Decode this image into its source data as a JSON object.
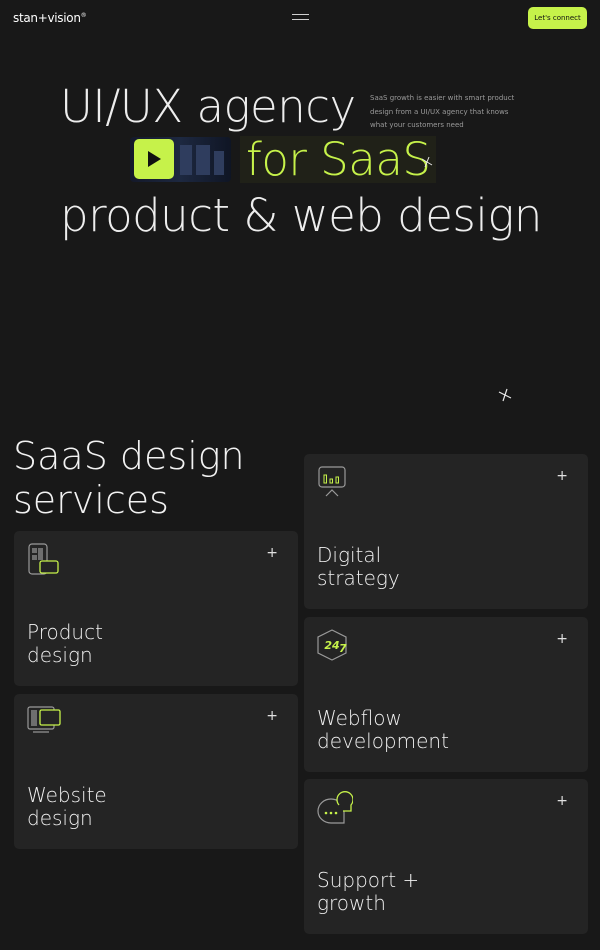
{
  "header": {
    "logo_text": "stan+vision",
    "logo_mark": "®",
    "menu_icon": "hamburger-icon",
    "cta_label": "Let's connect",
    "accent_color": "#c6f24a"
  },
  "hero": {
    "line1": "UI/UX agency",
    "line2": "for SaaS",
    "line3": "product & web design",
    "aside": "SaaS growth is easier with smart product design from a UI/UX agency that knows what your customers need",
    "play_icon": "play-icon"
  },
  "services": {
    "title_line1": "SaaS design",
    "title_line2": "services",
    "left": [
      {
        "line1": "Product",
        "line2": "design",
        "icon": "mobile-app-icon"
      },
      {
        "line1": "Website",
        "line2": "design",
        "icon": "browser-window-icon"
      }
    ],
    "right": [
      {
        "line1": "Digital",
        "line2": "strategy",
        "icon": "analytics-chart-icon"
      },
      {
        "line1": "Webflow",
        "line2": "development",
        "icon": "webflow-247-icon"
      },
      {
        "line1": "Support +",
        "line2": "growth",
        "icon": "chat-bubble-icon"
      }
    ],
    "plus_symbol": "+"
  }
}
